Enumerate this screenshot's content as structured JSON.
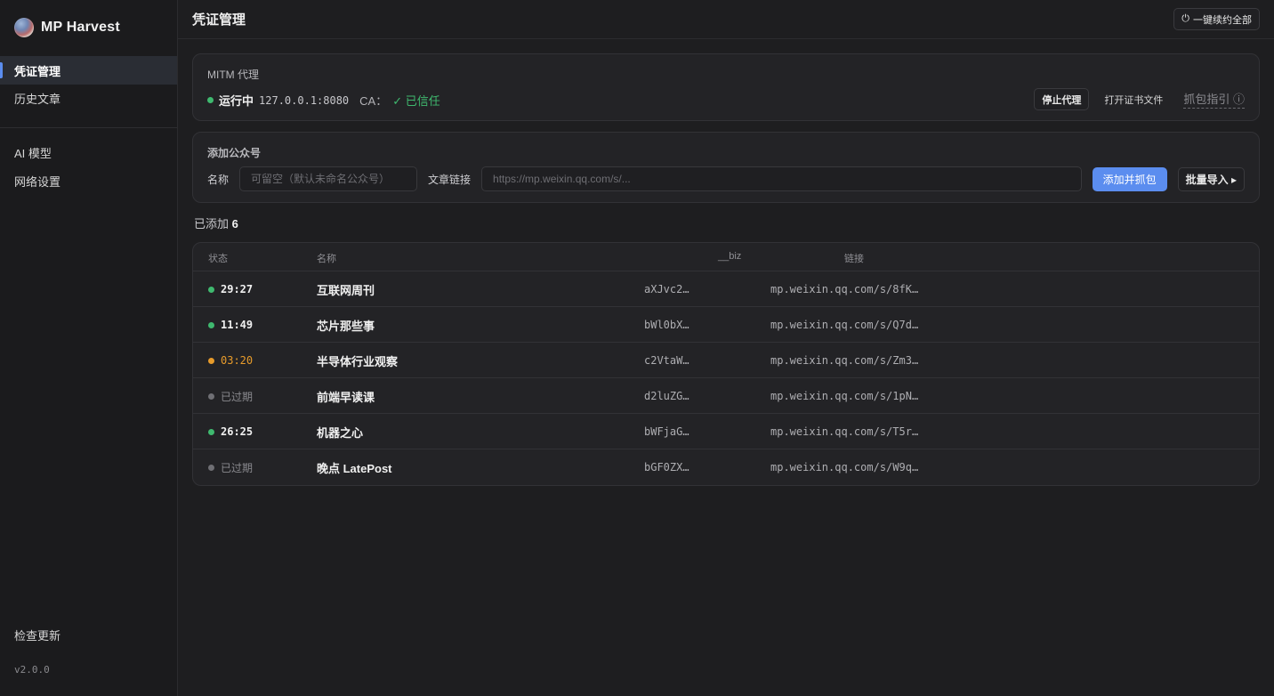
{
  "app": {
    "name": "MP Harvest",
    "version": "v2.0.0"
  },
  "sidebar": {
    "items": [
      {
        "label": "凭证管理"
      },
      {
        "label": "历史文章"
      },
      {
        "label": "AI 模型"
      },
      {
        "label": "网络设置"
      }
    ],
    "check_update": "检查更新"
  },
  "header": {
    "title": "凭证管理",
    "renew_all": "一键续约全部"
  },
  "mitm": {
    "title": "MITM 代理",
    "status": "运行中",
    "address": "127.0.0.1:8080",
    "ca_label": "CA：",
    "ca_status": "✓ 已信任",
    "stop_button": "停止代理",
    "open_cert": "打开证书文件",
    "guide": "抓包指引 ⓘ"
  },
  "add_account": {
    "title": "添加公众号",
    "name_label": "名称",
    "name_placeholder": "可留空（默认未命名公众号）",
    "link_label": "文章链接",
    "link_placeholder": "https://mp.weixin.qq.com/s/...",
    "add_button": "添加并抓包",
    "batch_button": "批量导入 ▸"
  },
  "summary": {
    "label": "已添加",
    "count": "6"
  },
  "table": {
    "headers": {
      "status": "状态",
      "name": "名称",
      "biz": "__biz",
      "link": "链接"
    },
    "rows": [
      {
        "status": "29:27",
        "state": "active",
        "name": "互联网周刊",
        "biz": "aXJvc2…",
        "link": "mp.weixin.qq.com/s/8fK…"
      },
      {
        "status": "11:49",
        "state": "active",
        "name": "芯片那些事",
        "biz": "bWl0bX…",
        "link": "mp.weixin.qq.com/s/Q7d…"
      },
      {
        "status": "03:20",
        "state": "warning",
        "name": "半导体行业观察",
        "biz": "c2VtaW…",
        "link": "mp.weixin.qq.com/s/Zm3…"
      },
      {
        "status": "已过期",
        "state": "expired",
        "name": "前端早读课",
        "biz": "d2luZG…",
        "link": "mp.weixin.qq.com/s/1pN…"
      },
      {
        "status": "26:25",
        "state": "active",
        "name": "机器之心",
        "biz": "bWFjaG…",
        "link": "mp.weixin.qq.com/s/T5r…"
      },
      {
        "status": "已过期",
        "state": "expired",
        "name": "晚点 LatePost",
        "biz": "bGF0ZX…",
        "link": "mp.weixin.qq.com/s/W9q…"
      }
    ]
  },
  "colors": {
    "accent": "#5b8def",
    "ok": "#3fb96f",
    "warn": "#e79b2b",
    "expired": "#6f6f74"
  }
}
